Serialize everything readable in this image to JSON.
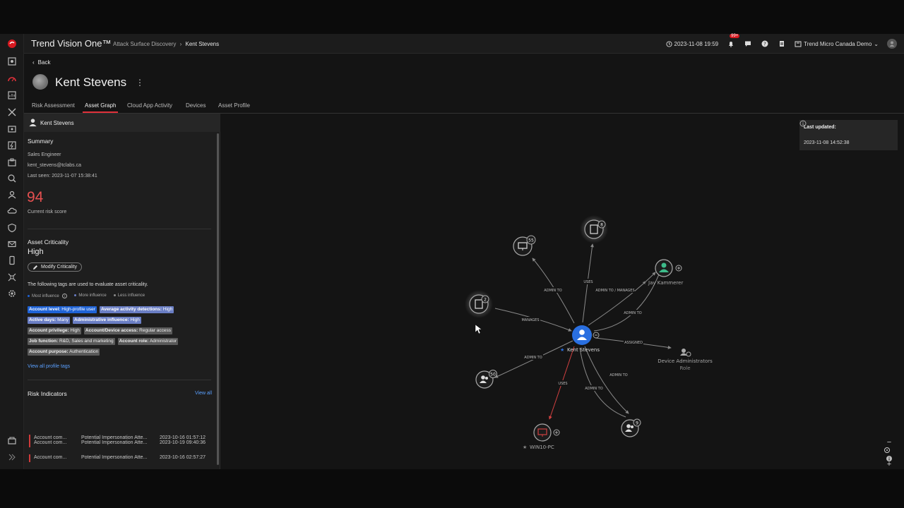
{
  "app": {
    "brand": "Trend Vision One™",
    "breadcrumb": {
      "parent": "Attack Surface Discovery",
      "separator": "›",
      "current": "Kent Stevens"
    },
    "datetime": "2023-11-08 19:59",
    "notification_count": "99+",
    "account": "Trend Micro Canada Demo"
  },
  "page": {
    "back_label": "Back",
    "title": "Kent Stevens",
    "more_label": "⋮",
    "tabs": [
      {
        "label": "Risk Assessment"
      },
      {
        "label": "Asset Graph"
      },
      {
        "label": "Cloud App Activity"
      },
      {
        "label": "Devices"
      },
      {
        "label": "Asset Profile"
      }
    ]
  },
  "panel": {
    "user_name": "Kent Stevens",
    "summary_heading": "Summary",
    "role": "Sales Engineer",
    "email": "kent_stevens@tclabs.ca",
    "last_seen": "Last seen: 2023-11-07 15:38:41",
    "risk_score": "94",
    "risk_score_label": "Current risk score",
    "criticality_heading": "Asset Criticality",
    "criticality_value": "High",
    "modify_label": "Modify Criticality",
    "tags_intro": "The following tags are used to evaluate asset criticality.",
    "legend": {
      "most": "Most influence",
      "more": "More influence",
      "less": "Less influence",
      "most_color": "#1f63d6",
      "more_color": "#6a7ec4",
      "less_color": "#8a8a8a"
    },
    "tags": [
      {
        "key": "Account level:",
        "value": "High-profile user"
      },
      {
        "key": "Average activity detections:",
        "value": "High"
      },
      {
        "key": "Active days:",
        "value": "Many"
      },
      {
        "key": "Administrative influence:",
        "value": "High"
      },
      {
        "key": "Account privilege:",
        "value": "High"
      },
      {
        "key": "Account/Device access:",
        "value": "Regular access"
      },
      {
        "key": "Job function:",
        "value": "R&D, Sales and marketing"
      },
      {
        "key": "Account role:",
        "value": "Administrator"
      },
      {
        "key": "Account purpose:",
        "value": "Authentication"
      }
    ],
    "view_all_tags": "View all profile tags",
    "risk_indicators_heading": "Risk Indicators",
    "view_all": "View all",
    "risk_indicators": [
      {
        "type": "Account com...",
        "name": "Potential Impersonation Atte...",
        "time": "2023-10-19 09:40:36"
      },
      {
        "type": "Account com...",
        "name": "Potential Impersonation Atte...",
        "time": "2023-10-16 02:57:27"
      },
      {
        "type": "Account com...",
        "name": "Potential Impersonation Atte...",
        "time": "2023-10-16 01:57:12"
      }
    ]
  },
  "graph": {
    "last_updated_label": "Last updated:",
    "last_updated_value": "2023-11-08 14:52:38",
    "center_label": "Kent Stevens",
    "node_labels": {
      "devices_55": "55",
      "apps_8": "8",
      "apps_2": "2",
      "users_50": "50",
      "users_9": "9",
      "jay": "Jay Kammerer",
      "device_admins": "Device Administrators",
      "device_admins_sub": "Role",
      "win10": "WIN10-PC"
    },
    "edge_labels": {
      "admin_to_1": "ADMIN TO",
      "uses_1": "USES",
      "admin_manages": "ADMIN TO / MANAGES",
      "admin_to_jay": "ADMIN TO",
      "manages": "MANAGES",
      "assigned": "ASSIGNED",
      "admin_to_50": "ADMIN TO",
      "uses_win10": "USES",
      "admin_to_low": "ADMIN TO",
      "admin_to_9": "ADMIN TO"
    },
    "zoom_in": "+",
    "zoom_out": "−",
    "accent": "#2a6fe0",
    "risk_edge_color": "#d04040"
  }
}
